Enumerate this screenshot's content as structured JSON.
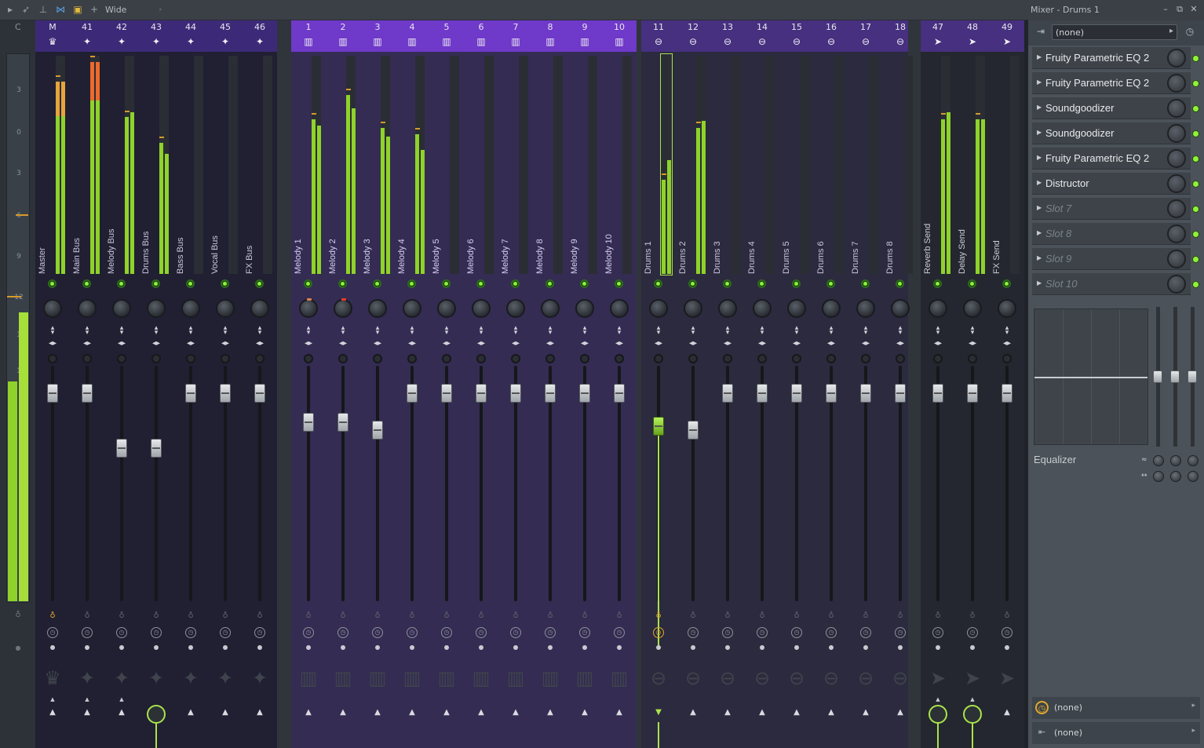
{
  "toolbar": {
    "icons": [
      "play-arrow-icon",
      "pointer-icon",
      "pin-icon",
      "link-icon",
      "square-icon",
      "plus-icon"
    ],
    "preset": "Wide"
  },
  "window": {
    "title": "Mixer - Drums 1",
    "minimize": "–",
    "restore": "⧉",
    "close": "✕"
  },
  "left_meter": {
    "label": "C",
    "scale": [
      "3",
      "0",
      "3",
      "6",
      "9",
      "12",
      "1",
      "1"
    ]
  },
  "groups": [
    {
      "id": "master",
      "color": "#211f32",
      "header": "#3c2a78"
    },
    {
      "id": "melody",
      "color": "#342c52",
      "header": "#6f39c9"
    },
    {
      "id": "drums",
      "color": "#2c2a3e",
      "header": "#46307f"
    },
    {
      "id": "sends",
      "color": "#24272f",
      "header": "#46307f"
    }
  ],
  "tracks": [
    {
      "num": "M",
      "name": "Master",
      "icon": "crown-icon",
      "glyph": "♛",
      "level": [
        0.88,
        0.88
      ],
      "peak": "orange"
    },
    {
      "num": "41",
      "name": "Main Bus",
      "icon": "waveform-icon",
      "glyph": "✦",
      "level": [
        0.97,
        0.97
      ],
      "peak": "red"
    },
    {
      "num": "42",
      "name": "Melody Bus",
      "icon": "waveform-icon",
      "glyph": "✦",
      "level": [
        0.72,
        0.74
      ]
    },
    {
      "num": "43",
      "name": "Drums Bus",
      "icon": "waveform-icon",
      "glyph": "✦",
      "level": [
        0.6,
        0.55
      ]
    },
    {
      "num": "44",
      "name": "Bass Bus",
      "icon": "waveform-icon",
      "glyph": "✦",
      "level": [
        0,
        0
      ]
    },
    {
      "num": "45",
      "name": "Vocal Bus",
      "icon": "waveform-icon",
      "glyph": "✦",
      "level": [
        0,
        0
      ]
    },
    {
      "num": "46",
      "name": "FX Bus",
      "icon": "waveform-icon",
      "glyph": "✦",
      "level": [
        0,
        0
      ]
    },
    {
      "num": "1",
      "name": "Melody 1",
      "icon": "piano-icon",
      "glyph": "▥",
      "level": [
        0.71,
        0.68
      ]
    },
    {
      "num": "2",
      "name": "Melody 2",
      "icon": "piano-icon",
      "glyph": "▥",
      "level": [
        0.82,
        0.76
      ]
    },
    {
      "num": "3",
      "name": "Melody 3",
      "icon": "piano-icon",
      "glyph": "▥",
      "level": [
        0.67,
        0.63
      ]
    },
    {
      "num": "4",
      "name": "Melody 4",
      "icon": "piano-icon",
      "glyph": "▥",
      "level": [
        0.64,
        0.57
      ]
    },
    {
      "num": "5",
      "name": "Melody 5",
      "icon": "piano-icon",
      "glyph": "▥",
      "level": [
        0,
        0
      ]
    },
    {
      "num": "6",
      "name": "Melody 6",
      "icon": "piano-icon",
      "glyph": "▥",
      "level": [
        0,
        0
      ]
    },
    {
      "num": "7",
      "name": "Melody 7",
      "icon": "piano-icon",
      "glyph": "▥",
      "level": [
        0,
        0
      ]
    },
    {
      "num": "8",
      "name": "Melody 8",
      "icon": "piano-icon",
      "glyph": "▥",
      "level": [
        0,
        0
      ]
    },
    {
      "num": "9",
      "name": "Melody 9",
      "icon": "piano-icon",
      "glyph": "▥",
      "level": [
        0,
        0
      ]
    },
    {
      "num": "10",
      "name": "Melody 10",
      "icon": "piano-icon",
      "glyph": "▥",
      "level": [
        0,
        0
      ]
    },
    {
      "num": "11",
      "name": "Drums 1",
      "icon": "drum-icon",
      "glyph": "⊖",
      "level": [
        0.43,
        0.52
      ],
      "selected": true
    },
    {
      "num": "12",
      "name": "Drums 2",
      "icon": "drum-icon",
      "glyph": "⊖",
      "level": [
        0.67,
        0.7
      ]
    },
    {
      "num": "13",
      "name": "Drums 3",
      "icon": "drum-icon",
      "glyph": "⊖",
      "level": [
        0,
        0
      ]
    },
    {
      "num": "14",
      "name": "Drums 4",
      "icon": "drum-icon",
      "glyph": "⊖",
      "level": [
        0,
        0
      ]
    },
    {
      "num": "15",
      "name": "Drums 5",
      "icon": "drum-icon",
      "glyph": "⊖",
      "level": [
        0,
        0
      ]
    },
    {
      "num": "16",
      "name": "Drums 6",
      "icon": "drum-icon",
      "glyph": "⊖",
      "level": [
        0,
        0
      ]
    },
    {
      "num": "17",
      "name": "Drums 7",
      "icon": "drum-icon",
      "glyph": "⊖",
      "level": [
        0,
        0
      ]
    },
    {
      "num": "18",
      "name": "Drums 8",
      "icon": "drum-icon",
      "glyph": "⊖",
      "level": [
        0,
        0
      ]
    },
    {
      "num": "47",
      "name": "Reverb Send",
      "icon": "send-icon",
      "glyph": "➤",
      "level": [
        0.71,
        0.74
      ]
    },
    {
      "num": "48",
      "name": "Delay Send",
      "icon": "send-icon",
      "glyph": "➤",
      "level": [
        0.71,
        0.71
      ]
    },
    {
      "num": "49",
      "name": "FX Send",
      "icon": "send-icon",
      "glyph": "➤",
      "level": [
        0,
        0
      ]
    }
  ],
  "right_panel": {
    "input": "(none)",
    "slots": [
      {
        "label": "Fruity Parametric EQ 2",
        "empty": false
      },
      {
        "label": "Fruity Parametric EQ 2",
        "empty": false
      },
      {
        "label": "Soundgoodizer",
        "empty": false
      },
      {
        "label": "Soundgoodizer",
        "empty": false
      },
      {
        "label": "Fruity Parametric EQ 2",
        "empty": false
      },
      {
        "label": "Distructor",
        "empty": false
      },
      {
        "label": "Slot 7",
        "empty": true
      },
      {
        "label": "Slot 8",
        "empty": true
      },
      {
        "label": "Slot 9",
        "empty": true
      },
      {
        "label": "Slot 10",
        "empty": true
      }
    ],
    "eq_label": "Equalizer",
    "bottom": [
      {
        "label": "(none)"
      },
      {
        "label": "(none)"
      }
    ]
  },
  "colors": {
    "meter_green": "#8fd22a",
    "meter_orange": "#e8a43c",
    "meter_red": "#ee6a2a",
    "accent": "#a9e44a"
  }
}
